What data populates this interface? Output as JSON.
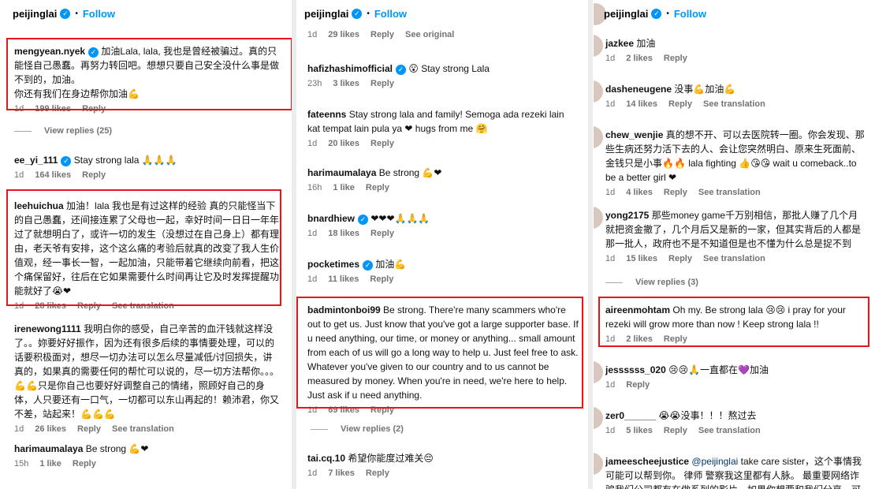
{
  "header": {
    "username": "peijinglai",
    "follow_label": "Follow",
    "verified_icon": "verified-badge-icon"
  },
  "colors": {
    "accent": "#0095f6",
    "highlight": "#e8141c",
    "meta": "#737373",
    "heart": "#ed4956"
  },
  "panel1": {
    "c1": {
      "user": "mengyean.nyek",
      "text": "加油Lala, lala, 我也是曾经被骗过。真的只能怪自己愚蠢。再努力转回吧。想想只要自己安全没什么事是做不到的，加油。\n你还有我们在身边帮你加油💪",
      "time": "1d",
      "likes": "199 likes",
      "reply": "Reply"
    },
    "view_replies": "View replies (25)",
    "c2": {
      "user": "ee_yi_111",
      "text": "Stay strong lala 🙏🙏🙏",
      "time": "1d",
      "likes": "164 likes",
      "reply": "Reply"
    },
    "c3": {
      "user": "leehuichua",
      "text": "加油！lala 我也是有过这样的经验 真的只能怪当下的自己愚蠢，还间接连累了父母也一起，幸好时间一日日一年年过了就想明白了，或许一切的发生（没想过在自己身上）都有理由，老天爷有安排，这个这么痛的考验后就真的改变了我人生价值观，经一事长一智，一起加油，只能带着它继续向前看，把这个痛保留好，往后在它如果需要什么时间再让它及时发挥提醒功能就好了😭❤",
      "time": "1d",
      "likes": "28 likes",
      "reply": "Reply",
      "translate": "See translation"
    },
    "c4": {
      "user": "irenewong1111",
      "text": "我明白你的感受，自己辛苦的血汗钱就这样没了。。妳要好好振作，因为还有很多后续的事情要处理，可以的话要积极面对，想尽一切办法可以怎么尽量减低/讨回损失，讲真的，如果真的需要任何的帮忙可以说的，尽一切方法帮你。。。💪💪只是你自己也要好好调整自己的情绪，照顾好自己的身体，人只要还有一口气，一切都可以东山再起的！赖沛君，你又不差，站起来！💪💪💪",
      "time": "1d",
      "likes": "26 likes",
      "reply": "Reply",
      "translate": "See translation"
    },
    "c5": {
      "user": "harimaumalaya",
      "text": "Be strong 💪❤",
      "time": "15h",
      "likes": "1 like",
      "reply": "Reply"
    }
  },
  "panel2": {
    "c0": {
      "time": "1d",
      "likes": "29 likes",
      "reply": "Reply",
      "original": "See original"
    },
    "c1": {
      "user": "hafizhashimofficial",
      "text": "😮 Stay strong Lala",
      "time": "23h",
      "likes": "3 likes",
      "reply": "Reply"
    },
    "c2": {
      "user": "fateenns",
      "text": "Stay strong lala and family! Semoga ada rezeki lain kat tempat lain pula ya ❤ hugs from me 🤗",
      "time": "1d",
      "likes": "20 likes",
      "reply": "Reply"
    },
    "c3": {
      "user": "harimaumalaya",
      "text": "Be strong 💪❤",
      "time": "16h",
      "likes": "1 like",
      "reply": "Reply"
    },
    "c4": {
      "user": "bnardhiew",
      "text": "❤❤❤🙏🙏🙏",
      "time": "1d",
      "likes": "18 likes",
      "reply": "Reply"
    },
    "c5": {
      "user": "pocketimes",
      "text": "加油💪",
      "time": "1d",
      "likes": "11 likes",
      "reply": "Reply"
    },
    "c6": {
      "user": "badmintonboi99",
      "text": "Be strong. There're many scammers who're out to get us. Just know that you've got a large supporter base. If u need anything, our time, or money or anything... small amount from each of us will go a long way to help u. Just feel free to ask. Whatever you've given to our country and to us cannot be measured by money. When you're in need, we're here to help. Just ask if u need anything.",
      "time": "1d",
      "likes": "69 likes",
      "reply": "Reply"
    },
    "view_replies": "View replies (2)",
    "c7": {
      "user": "tai.cq.10",
      "text": "希望你能度过难关😔",
      "time": "1d",
      "likes": "7 likes",
      "reply": "Reply"
    }
  },
  "panel3": {
    "c1": {
      "user": "jazkee",
      "text": "加油",
      "time": "1d",
      "likes": "2 likes",
      "reply": "Reply"
    },
    "c2": {
      "user": "dasheneugene",
      "text": "没事💪加油💪",
      "time": "1d",
      "likes": "14 likes",
      "reply": "Reply",
      "translate": "See translation"
    },
    "c3": {
      "user": "chew_wenjie",
      "text": "真的想不开、可以去医院转一圈。你会发现、那些生病还努力活下去的人、会让您突然明白、原来生死面前、金钱只是小事🔥🔥 lala fighting 👍😘😘 wait u comeback..to be a better girl ❤",
      "time": "1d",
      "likes": "4 likes",
      "reply": "Reply",
      "translate": "See translation"
    },
    "c4": {
      "user": "yong2175",
      "text": "那些money game千万别相信，那批人赚了几个月就把资金撤了，几个月后又是新的一家，但其实背后的人都是那一批人，政府也不是不知道但是也不懂为什么总是捉不到",
      "time": "1d",
      "likes": "15 likes",
      "reply": "Reply",
      "translate": "See translation"
    },
    "view_replies": "View replies (3)",
    "c5": {
      "user": "aireenmohtam",
      "text": "Oh my. Be strong lala 😢😢 i pray for your rezeki will grow more than now ! Keep strong lala !!",
      "time": "1d",
      "likes": "2 likes",
      "reply": "Reply"
    },
    "c6": {
      "user": "jessssss_020",
      "text": "😢😢🙏一直都在💜加油",
      "time": "1d",
      "reply": "Reply"
    },
    "c7": {
      "user": "zer0______",
      "text": "😭😭没事！！！熬过去",
      "time": "1d",
      "likes": "5 likes",
      "reply": "Reply",
      "translate": "See translation"
    },
    "c8": {
      "user": "jameescheejustice",
      "mention": "@peijinglai",
      "text": "take care sister，这个事情我可能可以帮到你。 律师 警察我这里都有人脉。 最重要网络诈骗我们公司都有在做系列的影片，如果你想要和我们分享，可能我们"
    }
  }
}
